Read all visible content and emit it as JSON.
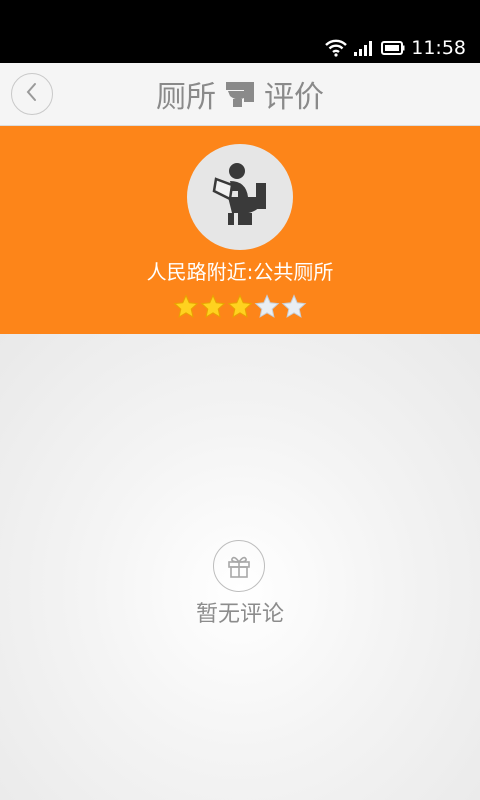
{
  "status_bar": {
    "time": "11:58"
  },
  "title_bar": {
    "title_part1": "厕所",
    "title_part2": "评价",
    "title_icon": "toilet-icon",
    "back_icon": "chevron-left-icon"
  },
  "header": {
    "place_name": "人民路附近:公共厕所",
    "rating": 3,
    "rating_max": 5,
    "avatar_icon": "person-on-toilet-icon",
    "accent_color": "#fd8519"
  },
  "empty_state": {
    "icon": "gift-icon",
    "text": "暂无评论"
  }
}
